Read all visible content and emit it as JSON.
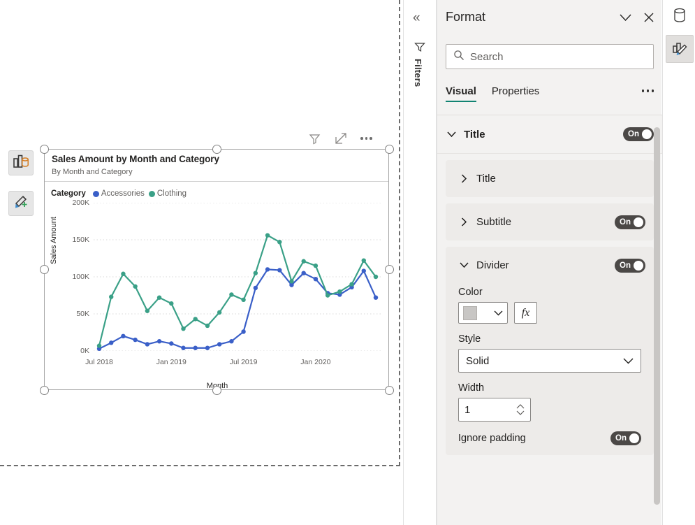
{
  "canvas": {
    "visual_header": {
      "filter_icon": "filter-funnel-icon",
      "focus_icon": "focus-mode-icon",
      "more_icon": "more-options-icon"
    },
    "float_buttons": [
      {
        "name": "visualizations-icon",
        "tooltip": "Visualizations"
      },
      {
        "name": "format-paintbrush-icon",
        "tooltip": "Format"
      }
    ]
  },
  "chart_data": {
    "type": "line",
    "title": "Sales Amount by Month and Category",
    "subtitle": "By Month and Category",
    "xlabel": "Month",
    "ylabel": "Sales Amount",
    "legend_title": "Category",
    "legend_position": "top",
    "grid": true,
    "ylim": [
      0,
      200000
    ],
    "yticks": [
      0,
      50000,
      100000,
      150000,
      200000
    ],
    "ytick_labels": [
      "0K",
      "50K",
      "100K",
      "150K",
      "200K"
    ],
    "xtick_labels": [
      "Jul 2018",
      "Jan 2019",
      "Jul 2019",
      "Jan 2020"
    ],
    "xtick_indices": [
      0,
      6,
      12,
      18
    ],
    "x": [
      "Jul 2018",
      "Aug 2018",
      "Sep 2018",
      "Oct 2018",
      "Nov 2018",
      "Dec 2018",
      "Jan 2019",
      "Feb 2019",
      "Mar 2019",
      "Apr 2019",
      "May 2019",
      "Jun 2019",
      "Jul 2019",
      "Aug 2019",
      "Sep 2019",
      "Oct 2019",
      "Nov 2019",
      "Dec 2019",
      "Jan 2020",
      "Feb 2020",
      "Mar 2020",
      "Apr 2020",
      "May 2020",
      "Jun 2020"
    ],
    "series": [
      {
        "name": "Accessories",
        "color": "#3A5FC8",
        "values": [
          3000,
          11000,
          20000,
          15000,
          9000,
          13000,
          10000,
          4000,
          4000,
          4000,
          9000,
          13000,
          26000,
          85000,
          110000,
          109000,
          89000,
          105000,
          97000,
          78000,
          76000,
          86000,
          108000,
          72000
        ]
      },
      {
        "name": "Clothing",
        "color": "#3AA087",
        "values": [
          7000,
          73000,
          104000,
          87000,
          54000,
          72000,
          64000,
          30000,
          43000,
          34000,
          52000,
          76000,
          69000,
          105000,
          156000,
          147000,
          94000,
          121000,
          115000,
          75000,
          80000,
          90000,
          122000,
          100000
        ]
      }
    ]
  },
  "filters_pane": {
    "expand_icon": "chevron-double-left-icon",
    "funnel_icon": "filter-funnel-icon",
    "label": "Filters"
  },
  "format_pane": {
    "title": "Format",
    "collapse_icon": "chevron-down-icon",
    "close_icon": "close-icon",
    "search": {
      "placeholder": "Search",
      "value": "",
      "icon": "search-icon"
    },
    "tabs": [
      {
        "label": "Visual",
        "active": true
      },
      {
        "label": "Properties",
        "active": false
      }
    ],
    "tabs_more_icon": "more-options-icon",
    "sections": {
      "title_group": {
        "label": "Title",
        "toggle": "On"
      },
      "title_card": {
        "label": "Title"
      },
      "subtitle_card": {
        "label": "Subtitle",
        "toggle": "On"
      },
      "divider_card": {
        "label": "Divider",
        "toggle": "On",
        "color_label": "Color",
        "color_value": "#C8C6C4",
        "fx_label": "fx",
        "style_label": "Style",
        "style_value": "Solid",
        "width_label": "Width",
        "width_value": "1",
        "ignore_padding_label": "Ignore padding",
        "ignore_padding_toggle": "On"
      }
    },
    "accent_color": "#118372"
  },
  "right_rail": {
    "buttons": [
      {
        "name": "data-model-icon",
        "active": false
      },
      {
        "name": "format-paintbrush-icon",
        "active": true
      }
    ]
  }
}
